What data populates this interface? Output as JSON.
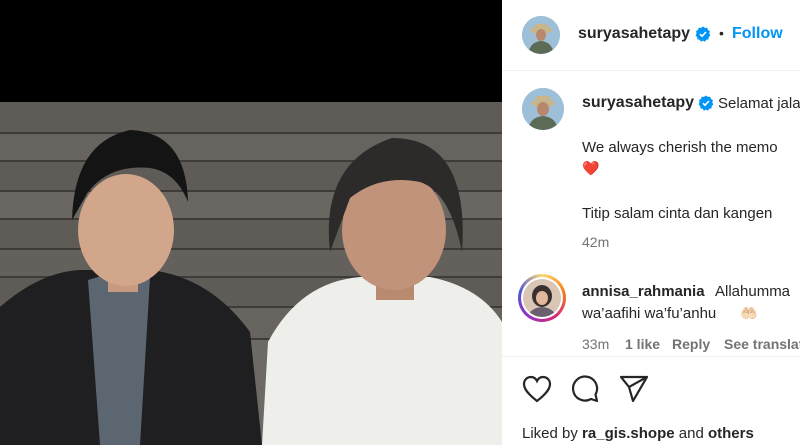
{
  "post": {
    "author": "suryasahetapy",
    "follow_label": "Follow",
    "dot": "•"
  },
  "caption": {
    "username": "suryasahetapy",
    "text_line1": "Selamat jala",
    "text_line2": "We always cherish the memo",
    "heart": "❤️",
    "text_line3": "Titip salam cinta dan kangen",
    "time": "42m"
  },
  "comment": {
    "username": "annisa_rahmania",
    "text_line1": "Allahumma",
    "text_line2": "wa’aafihi wa’fu’anhu",
    "emoji": "🤲🏻",
    "time": "33m",
    "likes": "1 like",
    "reply": "Reply",
    "translate": "See translat"
  },
  "actions": {
    "liked_by_prefix": "Liked by",
    "liked_by_user": "ra_gis.shope",
    "liked_by_and": "and",
    "liked_by_others": "others"
  },
  "colors": {
    "link_blue": "#0095f6",
    "verified_blue": "#0095f6",
    "heart_red": "#ed4956"
  }
}
